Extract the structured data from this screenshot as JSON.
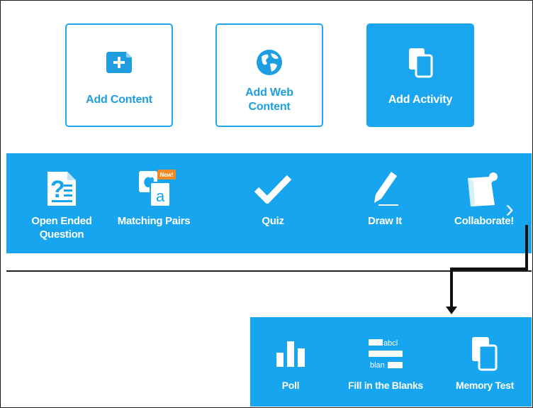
{
  "top_buttons": [
    {
      "label": "Add Content",
      "icon": "add-content-icon"
    },
    {
      "label": "Add Web Content",
      "icon": "globe-icon"
    },
    {
      "label": "Add Activity",
      "icon": "activity-cards-icon"
    }
  ],
  "activities": [
    {
      "label": "Open Ended Question",
      "icon": "question-document-icon"
    },
    {
      "label": "Matching Pairs",
      "icon": "matching-pairs-icon",
      "badge": "New!"
    },
    {
      "label": "Quiz",
      "icon": "checkmark-icon"
    },
    {
      "label": "Draw It",
      "icon": "pencil-icon"
    },
    {
      "label": "Collaborate!",
      "icon": "pinned-note-icon"
    }
  ],
  "more_activities": [
    {
      "label": "Poll",
      "icon": "bar-chart-icon"
    },
    {
      "label": "Fill in the Blanks",
      "icon": "fill-blanks-icon",
      "sample_top": "abcl",
      "sample_bottom": "blan"
    },
    {
      "label": "Memory Test",
      "icon": "memory-cards-icon"
    }
  ],
  "next_arrow": "›",
  "colors": {
    "accent": "#17a5ef",
    "accent_text": "#1e9ee0",
    "connector": "#111111"
  }
}
